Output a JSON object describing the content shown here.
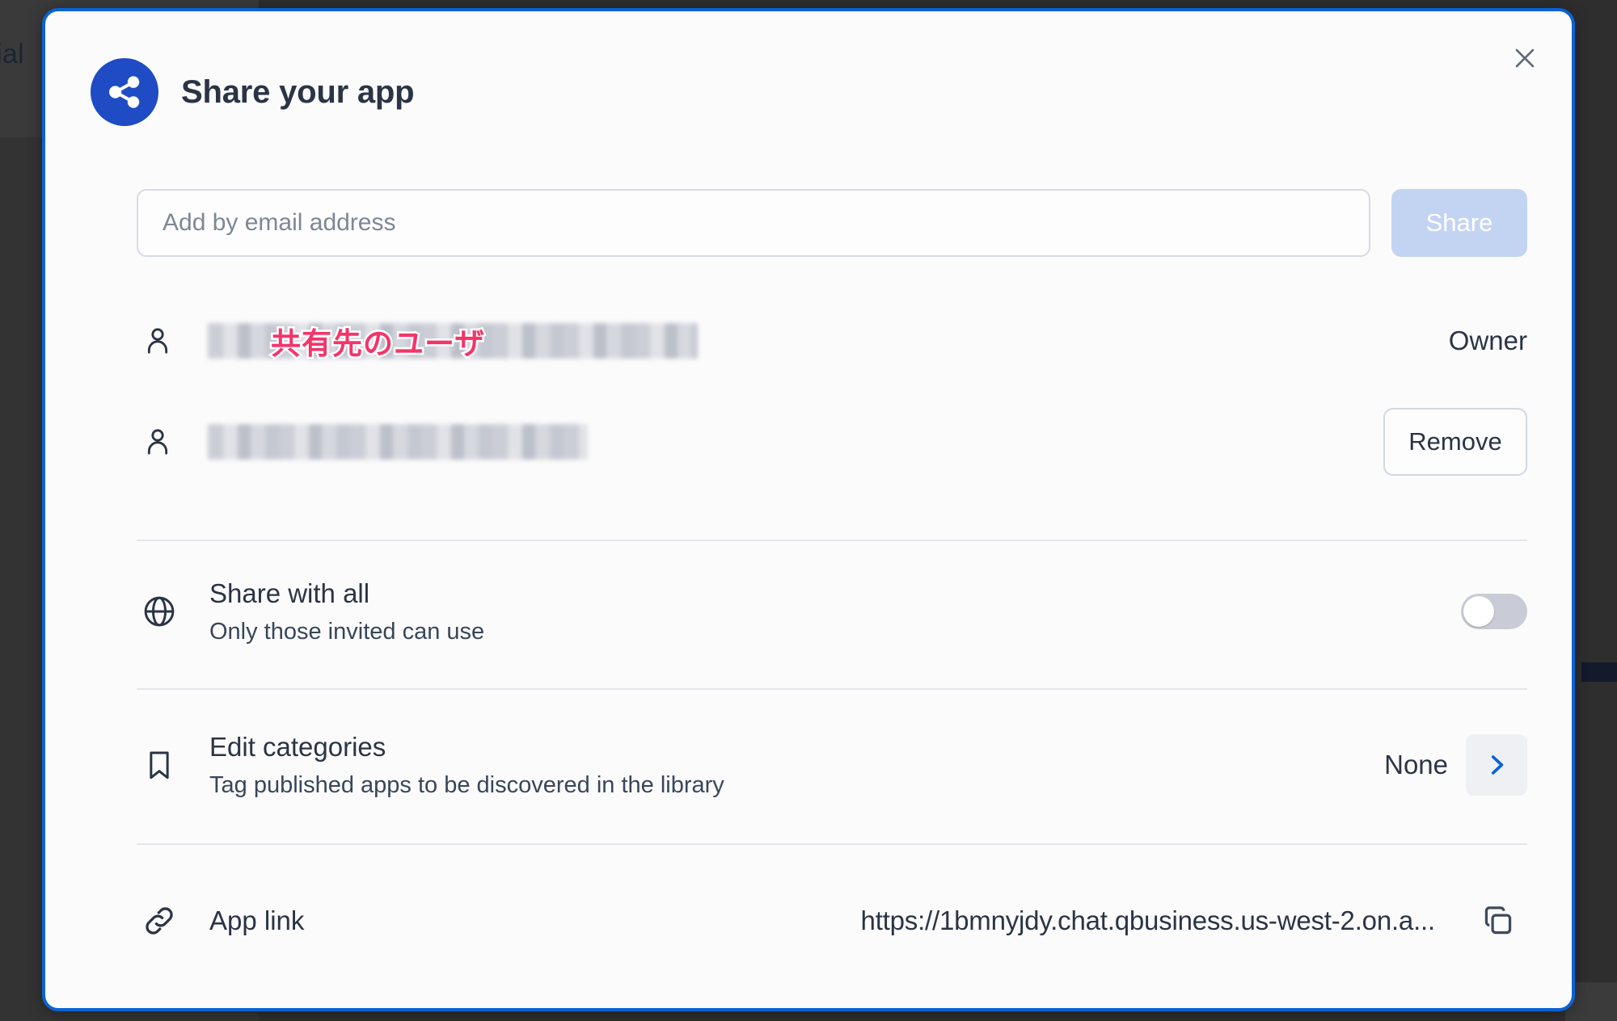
{
  "backdrop": {
    "partial_text": "cial"
  },
  "modal": {
    "title": "Share your app",
    "close_label": "×",
    "share_app_icon": "share-nodes-icon",
    "invite": {
      "placeholder": "Add by email address",
      "value": "",
      "share_button_label": "Share",
      "share_button_enabled": false
    },
    "people": [
      {
        "icon": "person-icon",
        "name_redacted": true,
        "annotation": "共有先のユーザ",
        "role_label": "Owner"
      },
      {
        "icon": "person-icon",
        "name_redacted": true,
        "annotation": "",
        "action_label": "Remove"
      }
    ],
    "options": [
      {
        "icon": "globe-icon",
        "title": "Share with all",
        "subtitle": "Only those invited can use",
        "control": "toggle",
        "toggle_on": false
      },
      {
        "icon": "bookmark-icon",
        "title": "Edit categories",
        "subtitle": "Tag published apps to be discovered in the library",
        "control": "chevron",
        "value": "None",
        "chevron_icon": "chevron-right-icon"
      },
      {
        "icon": "link-icon",
        "title": "App link",
        "subtitle": "",
        "control": "copy",
        "value": "https://1bmnyjdy.chat.qbusiness.us-west-2.on.a...",
        "copy_icon": "copy-icon"
      }
    ]
  },
  "colors": {
    "accent_blue": "#1f4cc4",
    "focus_border": "#0a63d4",
    "annotation_pink": "#f3356a",
    "text_dark": "#2b3445",
    "disabled_button": "#c3d4f2"
  }
}
